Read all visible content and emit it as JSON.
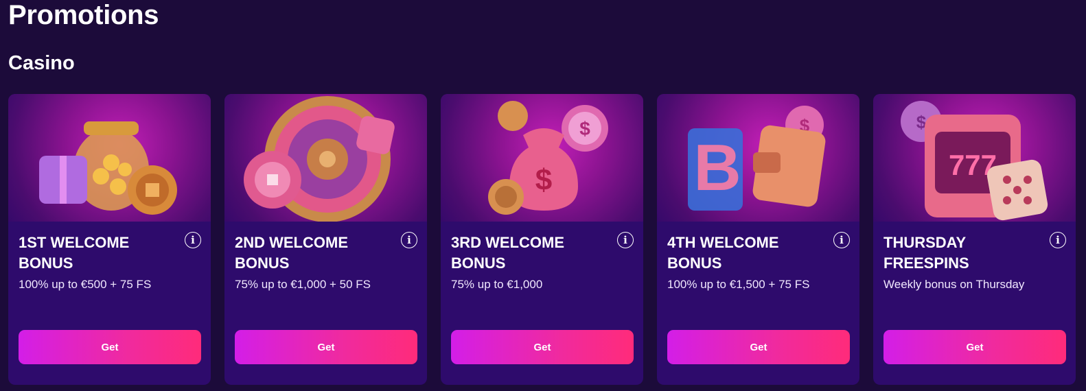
{
  "page": {
    "title": "Promotions",
    "section": "Casino"
  },
  "colors": {
    "background": "#1c0b3a",
    "card": "#2e0b6c",
    "button_start": "#d31ee8",
    "button_end": "#ff2b7a"
  },
  "cards": [
    {
      "title": "1ST WELCOME BONUS",
      "description": "100% up to €500 + 75 FS",
      "button": "Get",
      "art": "gift-and-coin-jar-icon"
    },
    {
      "title": "2ND WELCOME BONUS",
      "description": "75% up to €1,000 + 50 FS",
      "button": "Get",
      "art": "roulette-wheel-icon"
    },
    {
      "title": "3RD WELCOME BONUS",
      "description": "75% up to €1,000",
      "button": "Get",
      "art": "money-bag-icon"
    },
    {
      "title": "4TH WELCOME BONUS",
      "description": "100% up to €1,500 + 75 FS",
      "button": "Get",
      "art": "bitcoin-wallet-icon"
    },
    {
      "title": "THURSDAY FREESPINS",
      "description": "Weekly bonus on Thursday",
      "button": "Get",
      "art": "slot-machine-dice-icon"
    }
  ]
}
